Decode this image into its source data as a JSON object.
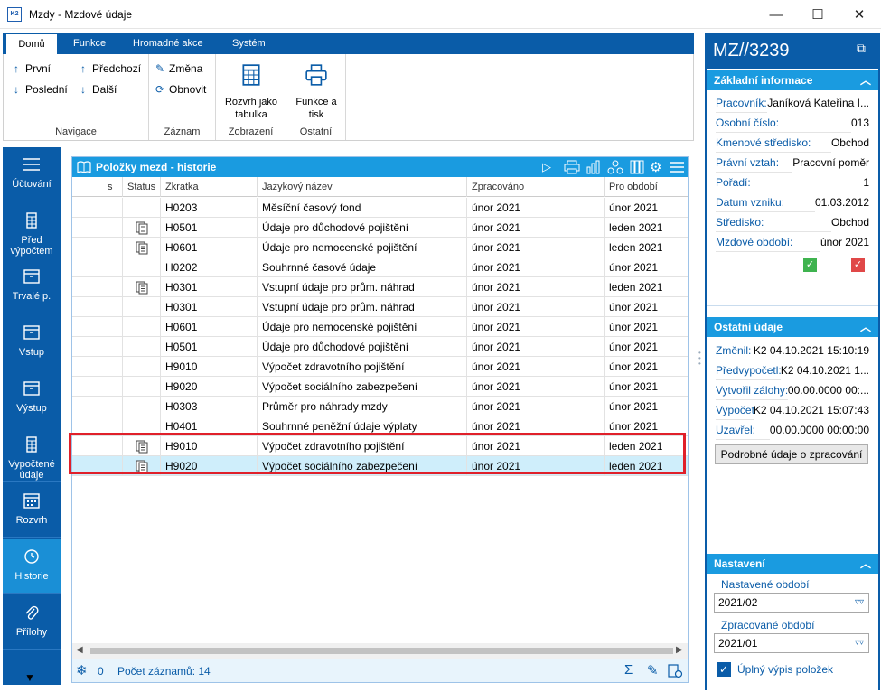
{
  "window": {
    "title": "Mzdy - Mzdové údaje",
    "minimize": "—",
    "maximize": "☐",
    "close": "✕",
    "app_badge": "K2"
  },
  "ribbon": {
    "tabs": [
      "Domů",
      "Funkce",
      "Hromadné akce",
      "Systém"
    ],
    "navigace": {
      "label": "Navigace",
      "prvni": "První",
      "predchozi": "Předchozí",
      "posledni": "Poslední",
      "dalsi": "Další"
    },
    "zaznam": {
      "label": "Záznam",
      "zmena": "Změna",
      "obnovit": "Obnovit"
    },
    "zobrazeni": {
      "label": "Zobrazení",
      "rozvrh": "Rozvrh jako tabulka"
    },
    "ostatni": {
      "label": "Ostatní",
      "funkce": "Funkce a tisk"
    }
  },
  "leftnav": [
    {
      "label": "Účtování",
      "icon": "list-icon"
    },
    {
      "label": "Před výpočtem",
      "icon": "calculator-icon"
    },
    {
      "label": "Trvalé p.",
      "icon": "box-icon"
    },
    {
      "label": "Vstup",
      "icon": "box-icon"
    },
    {
      "label": "Výstup",
      "icon": "box-icon"
    },
    {
      "label": "Vypočtené údaje",
      "icon": "calculator-icon"
    },
    {
      "label": "Rozvrh",
      "icon": "calendar-icon"
    },
    {
      "label": "Historie",
      "icon": "clock-icon"
    },
    {
      "label": "Přílohy",
      "icon": "paperclip-icon"
    }
  ],
  "grid": {
    "title": "Položky mezd - historie",
    "columns": [
      "s",
      "Status",
      "Zkratka",
      "Jazykový název",
      "Zpracováno",
      "Pro období"
    ],
    "rows": [
      {
        "doc": false,
        "zkratka": "H0203",
        "nazev": "Měsíční časový fond",
        "zpracovano": "únor 2021",
        "obdobi": "únor 2021"
      },
      {
        "doc": true,
        "zkratka": "H0501",
        "nazev": "Údaje pro důchodové pojištění",
        "zpracovano": "únor 2021",
        "obdobi": "leden 2021"
      },
      {
        "doc": true,
        "zkratka": "H0601",
        "nazev": "Údaje pro nemocenské pojištění",
        "zpracovano": "únor 2021",
        "obdobi": "leden 2021"
      },
      {
        "doc": false,
        "zkratka": "H0202",
        "nazev": "Souhrnné časové údaje",
        "zpracovano": "únor 2021",
        "obdobi": "únor 2021"
      },
      {
        "doc": true,
        "zkratka": "H0301",
        "nazev": "Vstupní údaje pro prům. náhrad",
        "zpracovano": "únor 2021",
        "obdobi": "leden 2021"
      },
      {
        "doc": false,
        "zkratka": "H0301",
        "nazev": "Vstupní údaje pro prům. náhrad",
        "zpracovano": "únor 2021",
        "obdobi": "únor 2021"
      },
      {
        "doc": false,
        "zkratka": "H0601",
        "nazev": "Údaje pro nemocenské pojištění",
        "zpracovano": "únor 2021",
        "obdobi": "únor 2021"
      },
      {
        "doc": false,
        "zkratka": "H0501",
        "nazev": "Údaje pro důchodové pojištění",
        "zpracovano": "únor 2021",
        "obdobi": "únor 2021"
      },
      {
        "doc": false,
        "zkratka": "H9010",
        "nazev": "Výpočet zdravotního pojištění",
        "zpracovano": "únor 2021",
        "obdobi": "únor 2021"
      },
      {
        "doc": false,
        "zkratka": "H9020",
        "nazev": "Výpočet sociálního zabezpečení",
        "zpracovano": "únor 2021",
        "obdobi": "únor 2021"
      },
      {
        "doc": false,
        "zkratka": "H0303",
        "nazev": "Průměr pro náhrady mzdy",
        "zpracovano": "únor 2021",
        "obdobi": "únor 2021"
      },
      {
        "doc": false,
        "zkratka": "H0401",
        "nazev": "Souhrnné peněžní údaje výplaty",
        "zpracovano": "únor 2021",
        "obdobi": "únor 2021"
      },
      {
        "doc": true,
        "zkratka": "H9010",
        "nazev": "Výpočet zdravotního pojištění",
        "zpracovano": "únor 2021",
        "obdobi": "leden 2021"
      },
      {
        "doc": true,
        "zkratka": "H9020",
        "nazev": "Výpočet sociálního zabezpečení",
        "zpracovano": "únor 2021",
        "obdobi": "leden 2021"
      }
    ],
    "footer": {
      "filter_count": "0",
      "record_count": "Počet záznamů: 14"
    }
  },
  "panel": {
    "title": "MZ//3239",
    "zakladni": {
      "label": "Základní informace",
      "rows": [
        {
          "k": "Pracovník:",
          "v": "Janíková Kateřina I..."
        },
        {
          "k": "Osobní číslo:",
          "v": "013"
        },
        {
          "k": "Kmenové středisko:",
          "v": "Obchod"
        },
        {
          "k": "Právní vztah:",
          "v": "Pracovní poměr"
        },
        {
          "k": "Pořadí:",
          "v": "1"
        },
        {
          "k": "Datum vzniku:",
          "v": "01.03.2012"
        },
        {
          "k": "Středisko:",
          "v": "Obchod"
        },
        {
          "k": "Mzdové období:",
          "v": "únor 2021"
        }
      ]
    },
    "ostatni": {
      "label": "Ostatní údaje",
      "rows": [
        {
          "k": "Změnil:",
          "v": "K2 04.10.2021 15:10:19"
        },
        {
          "k": "Předvypočetl:",
          "v": "K2 04.10.2021 1..."
        },
        {
          "k": "Vytvořil zálohy:",
          "v": "00.00.0000 00:..."
        },
        {
          "k": "Vypočetl:",
          "v": "K2 04.10.2021 15:07:43"
        },
        {
          "k": "Uzavřel:",
          "v": "00.00.0000 00:00:00"
        }
      ],
      "button": "Podrobné údaje o zpracování"
    },
    "nastaveni": {
      "label": "Nastavení",
      "nastavene_label": "Nastavené období",
      "nastavene_value": "2021/02",
      "zpracovane_label": "Zpracované období",
      "zpracovane_value": "2021/01",
      "checkbox_label": "Úplný výpis položek"
    }
  },
  "colors": {
    "ribbon_blue": "#0a5ca8",
    "header_blue": "#1a9be0",
    "highlight_red": "#e0202a",
    "select_bg": "#cfeefb"
  }
}
